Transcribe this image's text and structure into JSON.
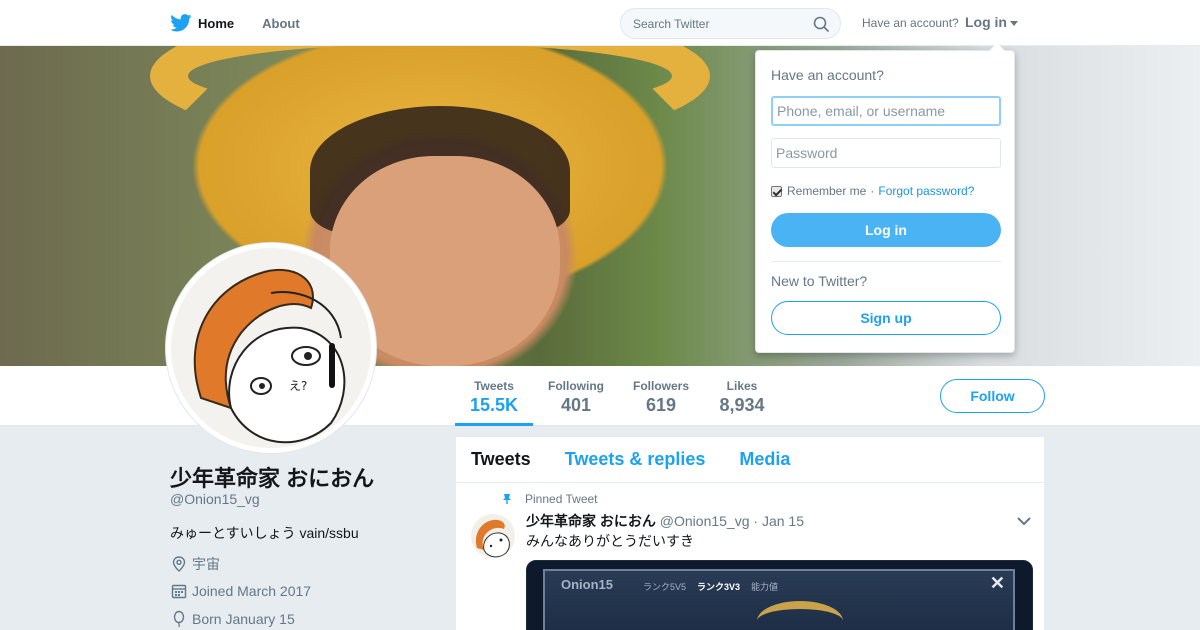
{
  "nav": {
    "home_label": "Home",
    "about_label": "About",
    "search_placeholder": "Search Twitter",
    "have_account": "Have an account?",
    "login_label": "Log in"
  },
  "stats": [
    {
      "label": "Tweets",
      "value": "15.5K"
    },
    {
      "label": "Following",
      "value": "401"
    },
    {
      "label": "Followers",
      "value": "619"
    },
    {
      "label": "Likes",
      "value": "8,934"
    }
  ],
  "follow_label": "Follow",
  "profile": {
    "name": "少年革命家 おにおん",
    "handle": "@Onion15_vg",
    "bio": "みゅーとすいしょう vain/ssbu",
    "location": "宇宙",
    "joined": "Joined March 2017",
    "born": "Born January 15"
  },
  "timeline": {
    "tabs": [
      "Tweets",
      "Tweets & replies",
      "Media"
    ],
    "pinned_label": "Pinned Tweet",
    "tweet": {
      "name": "少年革命家 おにおん",
      "handle": "@Onion15_vg",
      "date": "· Jan 15",
      "text": "みんなありがとうだいすき",
      "media": {
        "title": "Onion15",
        "rank1": "ランク5V5",
        "rank2": "ランク3V3",
        "rank3": "能力値",
        "close": "✕"
      }
    }
  },
  "login_dropdown": {
    "title": "Have an account?",
    "username_placeholder": "Phone, email, or username",
    "password_placeholder": "Password",
    "remember_label": "Remember me",
    "separator": "·",
    "forgot_label": "Forgot password?",
    "login_button": "Log in",
    "new_label": "New to Twitter?",
    "signup_button": "Sign up"
  },
  "colors": {
    "accent": "#1da1f2",
    "login_button": "#4ab3f4",
    "background": "#e6ecf0"
  },
  "icons": [
    "twitter-bird-icon",
    "search-icon",
    "location-icon",
    "calendar-icon",
    "balloon-icon",
    "pin-icon",
    "chevron-down-icon",
    "close-icon"
  ]
}
